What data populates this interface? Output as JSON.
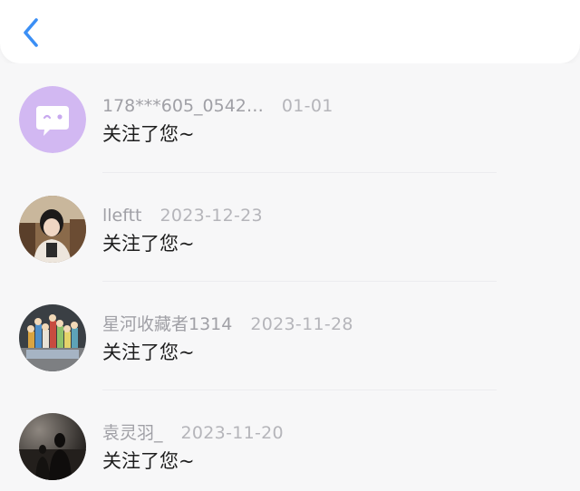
{
  "header": {
    "back_icon": "chevron-left-icon",
    "accent": "#3b8ff5"
  },
  "items": [
    {
      "name": "178***605_0542…",
      "time": "01-01",
      "message": "关注了您~",
      "avatar": "default-chat-avatar"
    },
    {
      "name": "lleftt",
      "time": "2023-12-23",
      "message": "关注了您~",
      "avatar": "user-photo-avatar"
    },
    {
      "name": "星河收藏者1314",
      "time": "2023-11-28",
      "message": "关注了您~",
      "avatar": "figurines-photo-avatar"
    },
    {
      "name": "袁灵羽_",
      "time": "2023-11-20",
      "message": "关注了您~",
      "avatar": "dark-silhouette-avatar"
    }
  ]
}
